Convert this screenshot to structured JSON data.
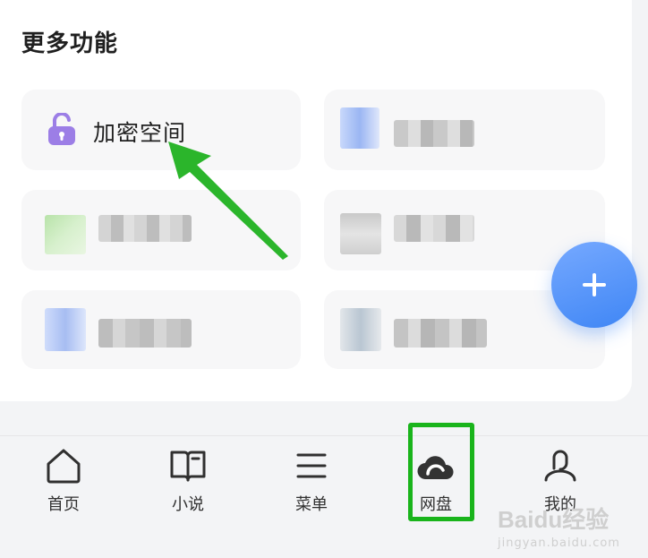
{
  "more_features": {
    "title": "更多功能",
    "cards": [
      {
        "label": "加密空间",
        "icon": "lock-open-icon",
        "color": "#9c7ee6"
      }
    ]
  },
  "fab": {
    "icon": "plus-icon",
    "color": "#4a8df7"
  },
  "tabbar": {
    "items": [
      {
        "label": "首页",
        "icon": "home-icon"
      },
      {
        "label": "小说",
        "icon": "book-icon"
      },
      {
        "label": "菜单",
        "icon": "menu-icon"
      },
      {
        "label": "网盘",
        "icon": "cloud-icon"
      },
      {
        "label": "我的",
        "icon": "user-icon"
      }
    ],
    "highlighted": "网盘",
    "highlight_color": "#19b41b"
  },
  "watermark": {
    "brand": "Baidu经验",
    "url": "jingyan.baidu.com"
  }
}
